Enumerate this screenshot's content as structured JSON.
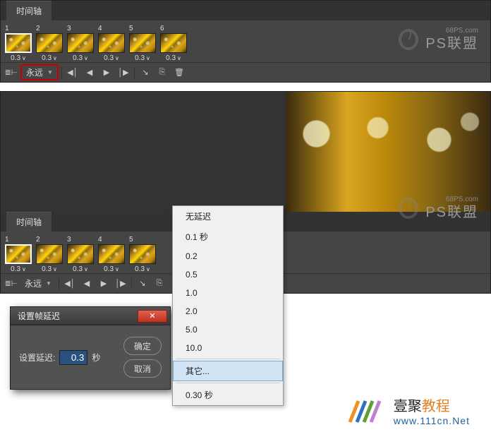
{
  "timeline_tab": "时间轴",
  "frames1": [
    {
      "num": "1",
      "delay": "0.3"
    },
    {
      "num": "2",
      "delay": "0.3"
    },
    {
      "num": "3",
      "delay": "0.3"
    },
    {
      "num": "4",
      "delay": "0.3"
    },
    {
      "num": "5",
      "delay": "0.3"
    },
    {
      "num": "6",
      "delay": "0.3"
    }
  ],
  "frames2": [
    {
      "num": "1",
      "delay": "0.3"
    },
    {
      "num": "2",
      "delay": "0.3"
    },
    {
      "num": "3",
      "delay": "0.3"
    },
    {
      "num": "4",
      "delay": "0.3"
    },
    {
      "num": "5",
      "delay": "0.3"
    }
  ],
  "loop_label": "永远",
  "delay_suffix": "∨",
  "delay_menu": {
    "no_delay": "无延迟",
    "items": [
      "0.1 秒",
      "0.2",
      "0.5",
      "1.0",
      "2.0",
      "5.0",
      "10.0"
    ],
    "other": "其它...",
    "current": "0.30 秒"
  },
  "dialog": {
    "title": "设置帧延迟",
    "label": "设置延迟:",
    "value": "0.3",
    "unit": "秒",
    "ok": "确定",
    "cancel": "取消"
  },
  "watermark": {
    "url": "68PS.com",
    "brand": "PS联盟"
  },
  "footer": {
    "brand_plain": "壹聚",
    "brand_accent": "教程",
    "url": "www.111cn.Net"
  }
}
